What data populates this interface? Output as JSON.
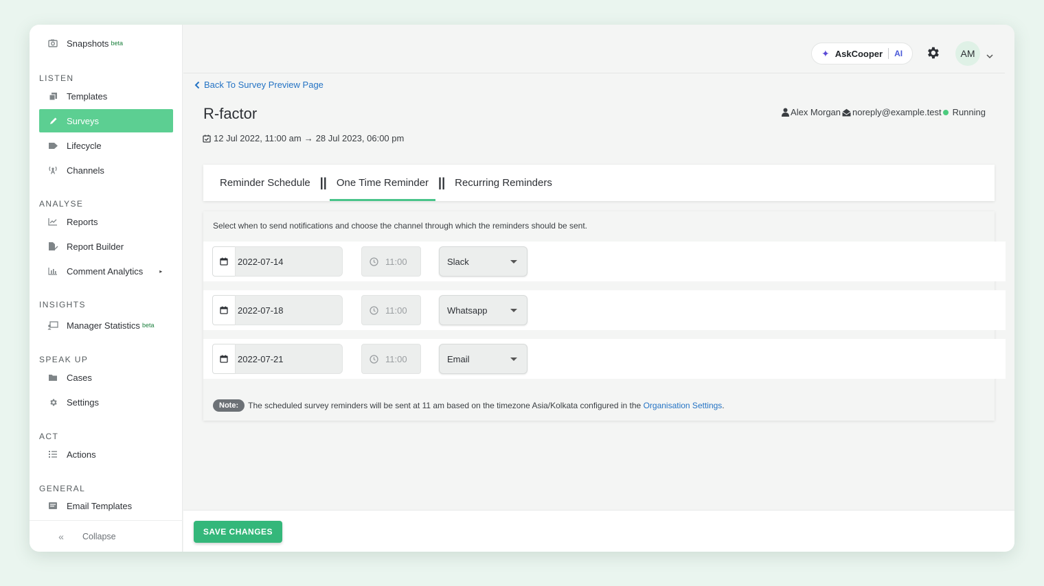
{
  "sidebar": {
    "top_item": {
      "label": "Snapshots",
      "badge": "beta",
      "icon": "camera-icon"
    },
    "sections": [
      {
        "title": "LISTEN",
        "items": [
          {
            "label": "Templates",
            "icon": "copy-icon"
          },
          {
            "label": "Surveys",
            "icon": "pencil-icon",
            "active": true
          },
          {
            "label": "Lifecycle",
            "icon": "flag-icon"
          },
          {
            "label": "Channels",
            "icon": "broadcast-icon"
          }
        ]
      },
      {
        "title": "ANALYSE",
        "items": [
          {
            "label": "Reports",
            "icon": "line-chart-icon"
          },
          {
            "label": "Report Builder",
            "icon": "file-edit-icon"
          },
          {
            "label": "Comment Analytics",
            "icon": "bar-chart-icon",
            "caret": "▸"
          }
        ]
      },
      {
        "title": "INSIGHTS",
        "items": [
          {
            "label": "Manager Statistics",
            "badge": "beta",
            "icon": "presentation-icon"
          }
        ]
      },
      {
        "title": "SPEAK UP",
        "items": [
          {
            "label": "Cases",
            "icon": "folder-icon"
          },
          {
            "label": "Settings",
            "icon": "gear-icon"
          }
        ]
      },
      {
        "title": "ACT",
        "items": [
          {
            "label": "Actions",
            "icon": "list-icon"
          }
        ]
      },
      {
        "title": "GENERAL",
        "items": [
          {
            "label": "Email Templates",
            "icon": "envelope-icon"
          }
        ]
      }
    ],
    "collapse": {
      "icon": "«",
      "label": "Collapse"
    }
  },
  "topbar": {
    "askcooper": {
      "label": "AskCooper",
      "suffix": "AI",
      "icon": "✦"
    },
    "avatar": "AM"
  },
  "back_link": "Back To Survey Preview Page",
  "page": {
    "title": "R-factor",
    "owner": "Alex Morgan",
    "email": "noreply@example.test",
    "status": "Running",
    "start": "12 Jul 2022, 11:00 am",
    "arrow": "→",
    "end": "28 Jul 2023, 06:00 pm"
  },
  "tabs": [
    {
      "label": "Reminder Schedule",
      "active": false
    },
    {
      "label": "One Time Reminder",
      "active": true
    },
    {
      "label": "Recurring Reminders",
      "active": false
    }
  ],
  "tab_separator": "||",
  "instructions": "Select when to send notifications and choose the channel through which the reminders should be sent.",
  "reminders": [
    {
      "date": "2022-07-14",
      "time": "11:00",
      "channel": "Slack"
    },
    {
      "date": "2022-07-18",
      "time": "11:00",
      "channel": "Whatsapp"
    },
    {
      "date": "2022-07-21",
      "time": "11:00",
      "channel": "Email"
    }
  ],
  "note": {
    "badge": "Note:",
    "text": "The scheduled survey reminders will be sent at 11 am based on the timezone Asia/Kolkata configured in the",
    "link": "Organisation Settings",
    "end": "."
  },
  "footer": {
    "save_label": "SAVE CHANGES"
  },
  "colors": {
    "accent": "#5ccf92",
    "link": "#2473c4",
    "save": "#34b77a",
    "status_dot": "#4ccb7e"
  }
}
